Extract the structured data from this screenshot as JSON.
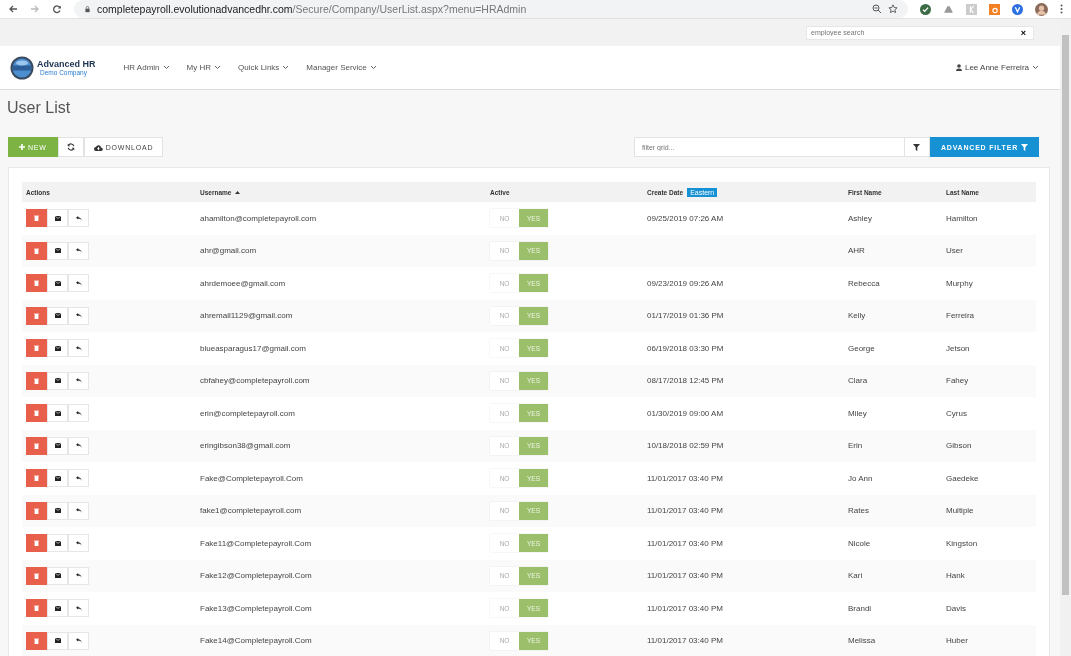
{
  "browser": {
    "url_host": "completepayroll.evolutionadvancedhr.com",
    "url_path": "/Secure/Company/UserList.aspx?menu=HRAdmin"
  },
  "top_search": {
    "placeholder": "employee search",
    "clear": "×"
  },
  "brand": {
    "name": "Advanced HR",
    "subtitle": "Demo Company"
  },
  "nav": [
    {
      "label": "HR Admin"
    },
    {
      "label": "My HR"
    },
    {
      "label": "Quick Links"
    },
    {
      "label": "Manager Service"
    }
  ],
  "user": {
    "name": "Lee Anne Ferreira"
  },
  "page_title": "User List",
  "toolbar": {
    "new": "NEW",
    "download": "DOWNLOAD",
    "filter_placeholder": "filter grid...",
    "advanced_filter": "ADVANCED FILTER"
  },
  "table": {
    "columns": [
      {
        "label": "Actions"
      },
      {
        "label": "Username",
        "sorted": true
      },
      {
        "label": "Active"
      },
      {
        "label": "Create Date",
        "badge": "Eastern"
      },
      {
        "label": "First Name"
      },
      {
        "label": "Last Name"
      }
    ],
    "rows": [
      {
        "username": "ahamilton@completepayroll.com",
        "no_label": "NO",
        "yes_label": "YES",
        "active": true,
        "create_date": "09/25/2019 07:26 AM",
        "first_name": "Ashley",
        "last_name": "Hamilton"
      },
      {
        "username": "ahr@gmail.com",
        "no_label": "NO",
        "yes_label": "YES",
        "active": true,
        "create_date": "",
        "first_name": "AHR",
        "last_name": "User"
      },
      {
        "username": "ahrdemoee@gmail.com",
        "no_label": "NO",
        "yes_label": "YES",
        "active": true,
        "create_date": "09/23/2019 09:26 AM",
        "first_name": "Rebecca",
        "last_name": "Murphy"
      },
      {
        "username": "ahremail1129@gmail.com",
        "no_label": "NO",
        "yes_label": "YES",
        "active": true,
        "create_date": "01/17/2019 01:36 PM",
        "first_name": "Kelly",
        "last_name": "Ferreira"
      },
      {
        "username": "blueasparagus17@gmail.com",
        "no_label": "NO",
        "yes_label": "YES",
        "active": true,
        "create_date": "06/19/2018 03:30 PM",
        "first_name": "George",
        "last_name": "Jetson"
      },
      {
        "username": "cbfahey@completepayroll.com",
        "no_label": "NO",
        "yes_label": "YES",
        "active": true,
        "create_date": "08/17/2018 12:45 PM",
        "first_name": "Clara",
        "last_name": "Fahey"
      },
      {
        "username": "erin@completepayroll.com",
        "no_label": "NO",
        "yes_label": "YES",
        "active": true,
        "create_date": "01/30/2019 09:00 AM",
        "first_name": "Miley",
        "last_name": "Cyrus"
      },
      {
        "username": "eringibson38@gmail.com",
        "no_label": "NO",
        "yes_label": "YES",
        "active": true,
        "create_date": "10/18/2018 02:59 PM",
        "first_name": "Erin",
        "last_name": "Gibson"
      },
      {
        "username": "Fake@Completepayroll.Com",
        "no_label": "NO",
        "yes_label": "YES",
        "active": true,
        "create_date": "11/01/2017 03:40 PM",
        "first_name": "Jo Ann",
        "last_name": "Gaedeke"
      },
      {
        "username": "fake1@completepayroll.com",
        "no_label": "NO",
        "yes_label": "YES",
        "active": true,
        "create_date": "11/01/2017 03:40 PM",
        "first_name": "Rates",
        "last_name": "Multiple"
      },
      {
        "username": "Fake11@Completepayroll.Com",
        "no_label": "NO",
        "yes_label": "YES",
        "active": true,
        "create_date": "11/01/2017 03:40 PM",
        "first_name": "Nicole",
        "last_name": "Kingston"
      },
      {
        "username": "Fake12@Completepayroll.Com",
        "no_label": "NO",
        "yes_label": "YES",
        "active": true,
        "create_date": "11/01/2017 03:40 PM",
        "first_name": "Kari",
        "last_name": "Hank"
      },
      {
        "username": "Fake13@Completepayroll.Com",
        "no_label": "NO",
        "yes_label": "YES",
        "active": true,
        "create_date": "11/01/2017 03:40 PM",
        "first_name": "Brandi",
        "last_name": "Davis"
      },
      {
        "username": "Fake14@Completepayroll.Com",
        "no_label": "NO",
        "yes_label": "YES",
        "active": true,
        "create_date": "11/01/2017 03:40 PM",
        "first_name": "Melissa",
        "last_name": "Huber"
      }
    ]
  }
}
